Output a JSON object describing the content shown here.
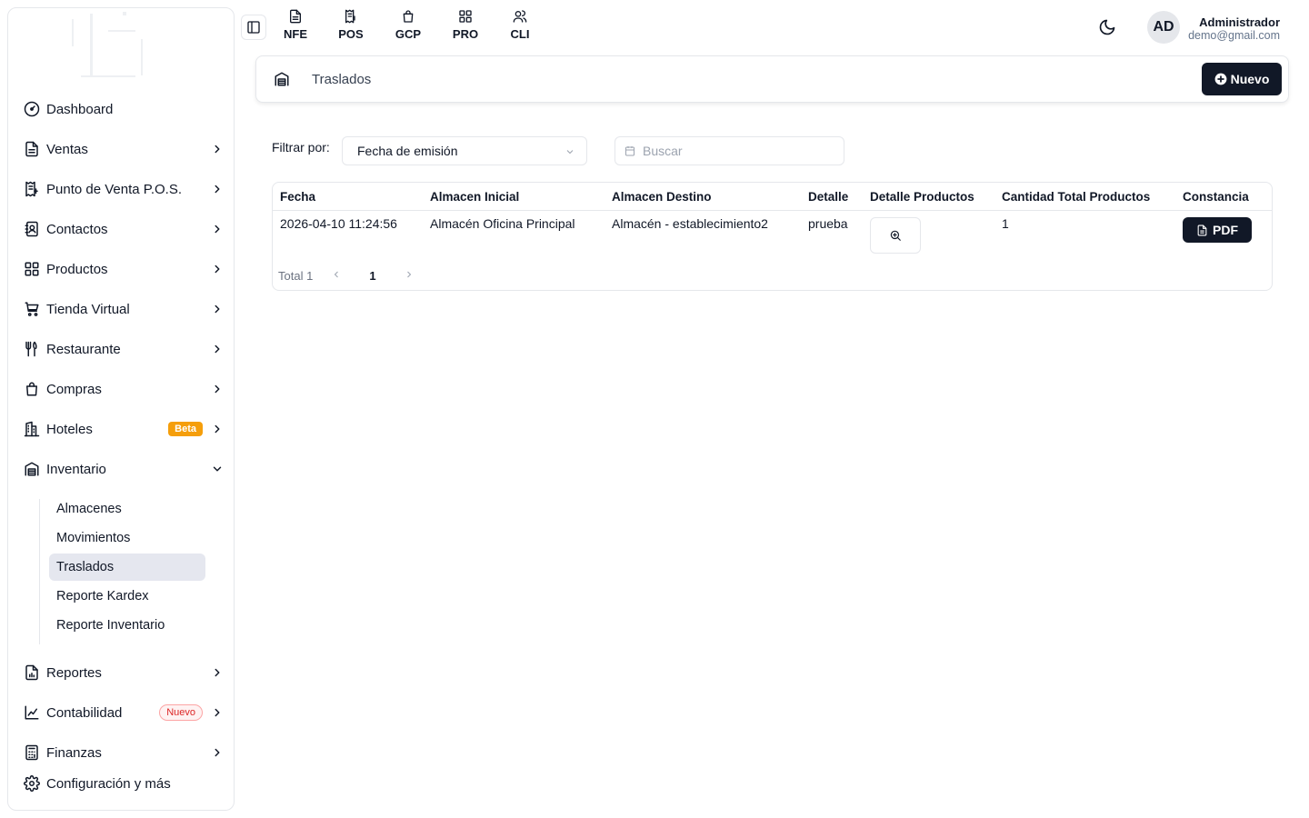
{
  "topbar": {
    "modules": [
      {
        "label": "NFE",
        "icon": "file-text-icon"
      },
      {
        "label": "POS",
        "icon": "receipt-icon"
      },
      {
        "label": "GCP",
        "icon": "shopping-bag-icon"
      },
      {
        "label": "PRO",
        "icon": "grid-icon"
      },
      {
        "label": "CLI",
        "icon": "users-icon"
      }
    ],
    "avatar_initials": "AD",
    "user_name": "Administrador",
    "user_email": "demo@gmail.com"
  },
  "sidebar": {
    "items": [
      {
        "label": "Dashboard",
        "icon": "dashboard-icon"
      },
      {
        "label": "Ventas",
        "icon": "file-icon"
      },
      {
        "label": "Punto de Venta P.O.S.",
        "icon": "receipt-icon"
      },
      {
        "label": "Contactos",
        "icon": "contacts-icon"
      },
      {
        "label": "Productos",
        "icon": "grid-icon"
      },
      {
        "label": "Tienda Virtual",
        "icon": "cart-icon"
      },
      {
        "label": "Restaurante",
        "icon": "utensils-icon"
      },
      {
        "label": "Compras",
        "icon": "bag-icon"
      },
      {
        "label": "Hoteles",
        "icon": "building-icon",
        "badge": "Beta"
      },
      {
        "label": "Inventario",
        "icon": "warehouse-icon"
      },
      {
        "label": "Reportes",
        "icon": "report-icon"
      },
      {
        "label": "Contabilidad",
        "icon": "chart-icon",
        "badge": "Nuevo"
      },
      {
        "label": "Finanzas",
        "icon": "calculator-icon"
      },
      {
        "label": "Configuración y más",
        "icon": "gear-icon"
      }
    ],
    "inventory_sub": [
      "Almacenes",
      "Movimientos",
      "Traslados",
      "Reporte Kardex",
      "Reporte Inventario"
    ],
    "active_sub": "Traslados"
  },
  "header": {
    "breadcrumb": "Traslados",
    "new_button": "Nuevo"
  },
  "filter": {
    "label": "Filtrar por:",
    "selected": "Fecha de emisión",
    "search_placeholder": "Buscar"
  },
  "table": {
    "columns": [
      "Fecha",
      "Almacen Inicial",
      "Almacen Destino",
      "Detalle",
      "Detalle Productos",
      "Cantidad Total Productos",
      "Constancia"
    ],
    "rows": [
      {
        "fecha": "2026-04-10 11:24:56",
        "almacen_inicial": "Almacén Oficina Principal",
        "almacen_destino": "Almacén - establecimiento2",
        "detalle": "prueba",
        "cantidad": "1",
        "constancia": "PDF"
      }
    ],
    "total_label": "Total 1",
    "current_page": "1"
  },
  "colors": {
    "primary": "#111827",
    "beta": "#f59e0b",
    "nuevo": "#dc2626",
    "active_bg": "#e5e7ef"
  }
}
